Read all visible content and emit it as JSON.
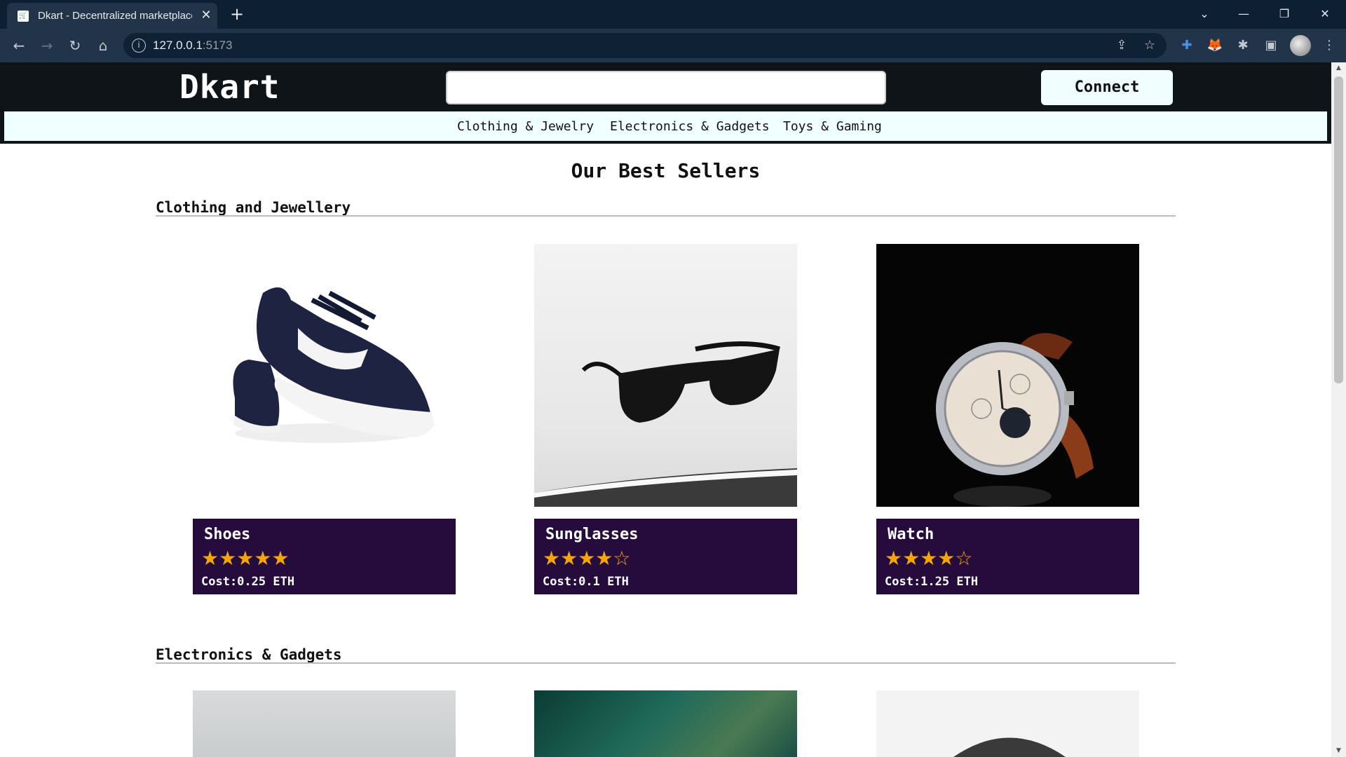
{
  "browser": {
    "tab_title": "Dkart - Decentralized marketplace",
    "url_host": "127.0.0.1",
    "url_port": ":5173"
  },
  "site": {
    "logo": "Dkart",
    "search_value": "",
    "connect_label": "Connect",
    "categories": [
      "Clothing & Jewelry",
      "Electronics & Gadgets",
      "Toys & Gaming"
    ],
    "page_title": "Our Best Sellers"
  },
  "sections": [
    {
      "title": "Clothing and Jewellery",
      "products": [
        {
          "name": "Shoes",
          "rating": 5,
          "stars": "★★★★★",
          "cost": "Cost:0.25 ETH"
        },
        {
          "name": "Sunglasses",
          "rating": 4,
          "stars": "★★★★☆",
          "cost": "Cost:0.1 ETH"
        },
        {
          "name": "Watch",
          "rating": 4,
          "stars": "★★★★☆",
          "cost": "Cost:1.25 ETH"
        }
      ]
    },
    {
      "title": "Electronics & Gadgets",
      "products": []
    }
  ],
  "colors": {
    "header_bg": "#0f1419",
    "card_info_bg": "#250c3d",
    "star": "#f7a500",
    "catnav_bg": "#f0ffff"
  }
}
